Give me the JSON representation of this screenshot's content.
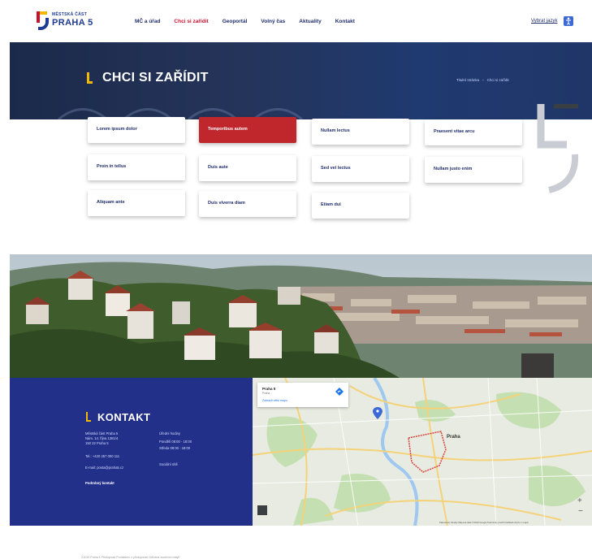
{
  "header": {
    "logo_small": "MĚSTSKÁ ČÁST",
    "logo_big": "PRAHA 5",
    "nav": [
      {
        "label": "MČ a úřad",
        "active": false
      },
      {
        "label": "Chci si zařídit",
        "active": true
      },
      {
        "label": "Geoportál",
        "active": false
      },
      {
        "label": "Volný čas",
        "active": false
      },
      {
        "label": "Aktuality",
        "active": false
      },
      {
        "label": "Kontakt",
        "active": false
      }
    ],
    "lang_label": "Vybrat jazyk",
    "lang_icon": "accessibility-icon"
  },
  "hero": {
    "title": "CHCI SI ZAŘÍDIT",
    "breadcrumb": [
      "Titulní stránka",
      "Chci si zařídit"
    ]
  },
  "tiles": [
    {
      "label": "Lorem ipsum dolor",
      "active": false
    },
    {
      "label": "Temporibus autem",
      "active": true
    },
    {
      "label": "Nullam lectus",
      "active": false
    },
    {
      "label": "Praesent vitae arcu",
      "active": false
    },
    {
      "label": "Proin in tellus",
      "active": false
    },
    {
      "label": "Duis aute",
      "active": false
    },
    {
      "label": "Sed vel lectus",
      "active": false
    },
    {
      "label": "Nullam justo enim",
      "active": false
    },
    {
      "label": "Aliquam ante",
      "active": false
    },
    {
      "label": "Duis viverra diam",
      "active": false
    },
    {
      "label": "Etiam dui",
      "active": false
    }
  ],
  "contact": {
    "title": "KONTAKT",
    "address": [
      "Městská část Praha 5",
      "Nám. 14. října 1381/4",
      "150 22 Praha 5"
    ],
    "phone": "Tel.: +420 257 000 111",
    "email": "E-mail: posta@praha5.cz",
    "link": "Podrobný kontakt",
    "hours_title": "Úřední hodiny",
    "hours": [
      "Pondělí   08:00 - 18:00",
      "Středa     08:00 - 18:00"
    ],
    "social_title": "Sociální sítě",
    "social": [
      "facebook-icon",
      "youtube-icon",
      "twitter-icon",
      "instagram-icon"
    ]
  },
  "map": {
    "card_title": "Praha 5",
    "card_sub": "Praha",
    "card_link": "Zobrazit větší mapu",
    "directions_label": "Trasy",
    "city_label": "Praha",
    "zoom_in": "+",
    "zoom_out": "−",
    "footer": "Klávesové zkratky   Mapová data ©2019 Google   Podmínky použití   Nahlásit chybu v mapě"
  },
  "footer": {
    "text": "©2019 Praha 5   Přístupnost   Prohlášení o přístupnosti   Ochrana osobních údajů"
  },
  "colors": {
    "brand_blue": "#1f3a93",
    "brand_red": "#c8102e",
    "brand_yellow": "#f5b800",
    "tile_active": "#c0272d",
    "contact_bg": "#223089"
  }
}
